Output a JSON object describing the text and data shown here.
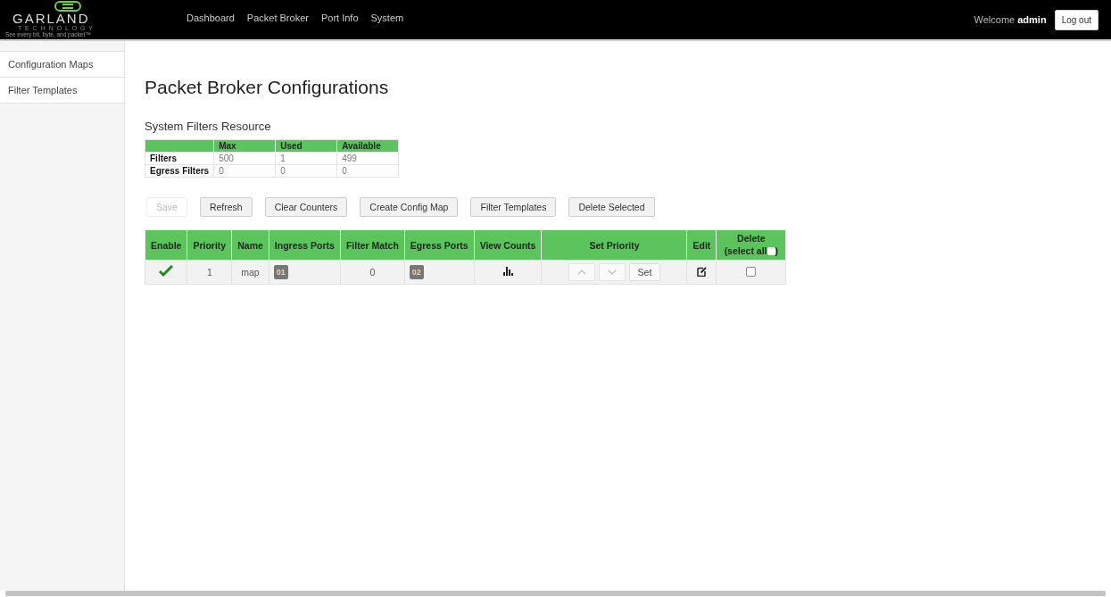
{
  "header": {
    "logo": {
      "name": "GARLAND",
      "tagline": "T E C H N O L O G Y",
      "slogan": "See every bit, byte, and packet™"
    },
    "nav": [
      {
        "label": "Dashboard"
      },
      {
        "label": "Packet Broker"
      },
      {
        "label": "Port Info"
      },
      {
        "label": "System"
      }
    ],
    "welcome": "Welcome",
    "user": "admin",
    "logout": "Log out"
  },
  "sidebar": {
    "items": [
      {
        "label": "Configuration Maps"
      },
      {
        "label": "Filter Templates"
      }
    ]
  },
  "title": "Packet Broker Configurations",
  "resource": {
    "title": "System Filters Resource",
    "columns": [
      "Max",
      "Used",
      "Available"
    ],
    "rows": [
      {
        "label": "Filters",
        "values": [
          "500",
          "1",
          "499"
        ]
      },
      {
        "label": "Egress Filters",
        "values": [
          "0",
          "0",
          "0"
        ]
      }
    ]
  },
  "buttons": [
    {
      "label": "Save",
      "disabled": true
    },
    {
      "label": "Refresh",
      "disabled": false
    },
    {
      "label": "Clear Counters",
      "disabled": false
    },
    {
      "label": "Create Config Map",
      "disabled": false
    },
    {
      "label": "Filter Templates",
      "disabled": false
    },
    {
      "label": "Delete Selected",
      "disabled": false
    }
  ],
  "table": {
    "columns": [
      "Enable",
      "Priority",
      "Name",
      "Ingress Ports",
      "Filter Match",
      "Egress Ports",
      "View Counts",
      "Set Priority",
      "Edit"
    ],
    "delete_column": {
      "label": "Delete",
      "select_all": "(select all",
      "close": ")",
      "checked": false
    },
    "rows": [
      {
        "enabled": true,
        "priority": "1",
        "name": "map",
        "ingress": "01",
        "filter_match": "0",
        "egress": "02",
        "set_label": "Set",
        "checked": false
      }
    ]
  }
}
